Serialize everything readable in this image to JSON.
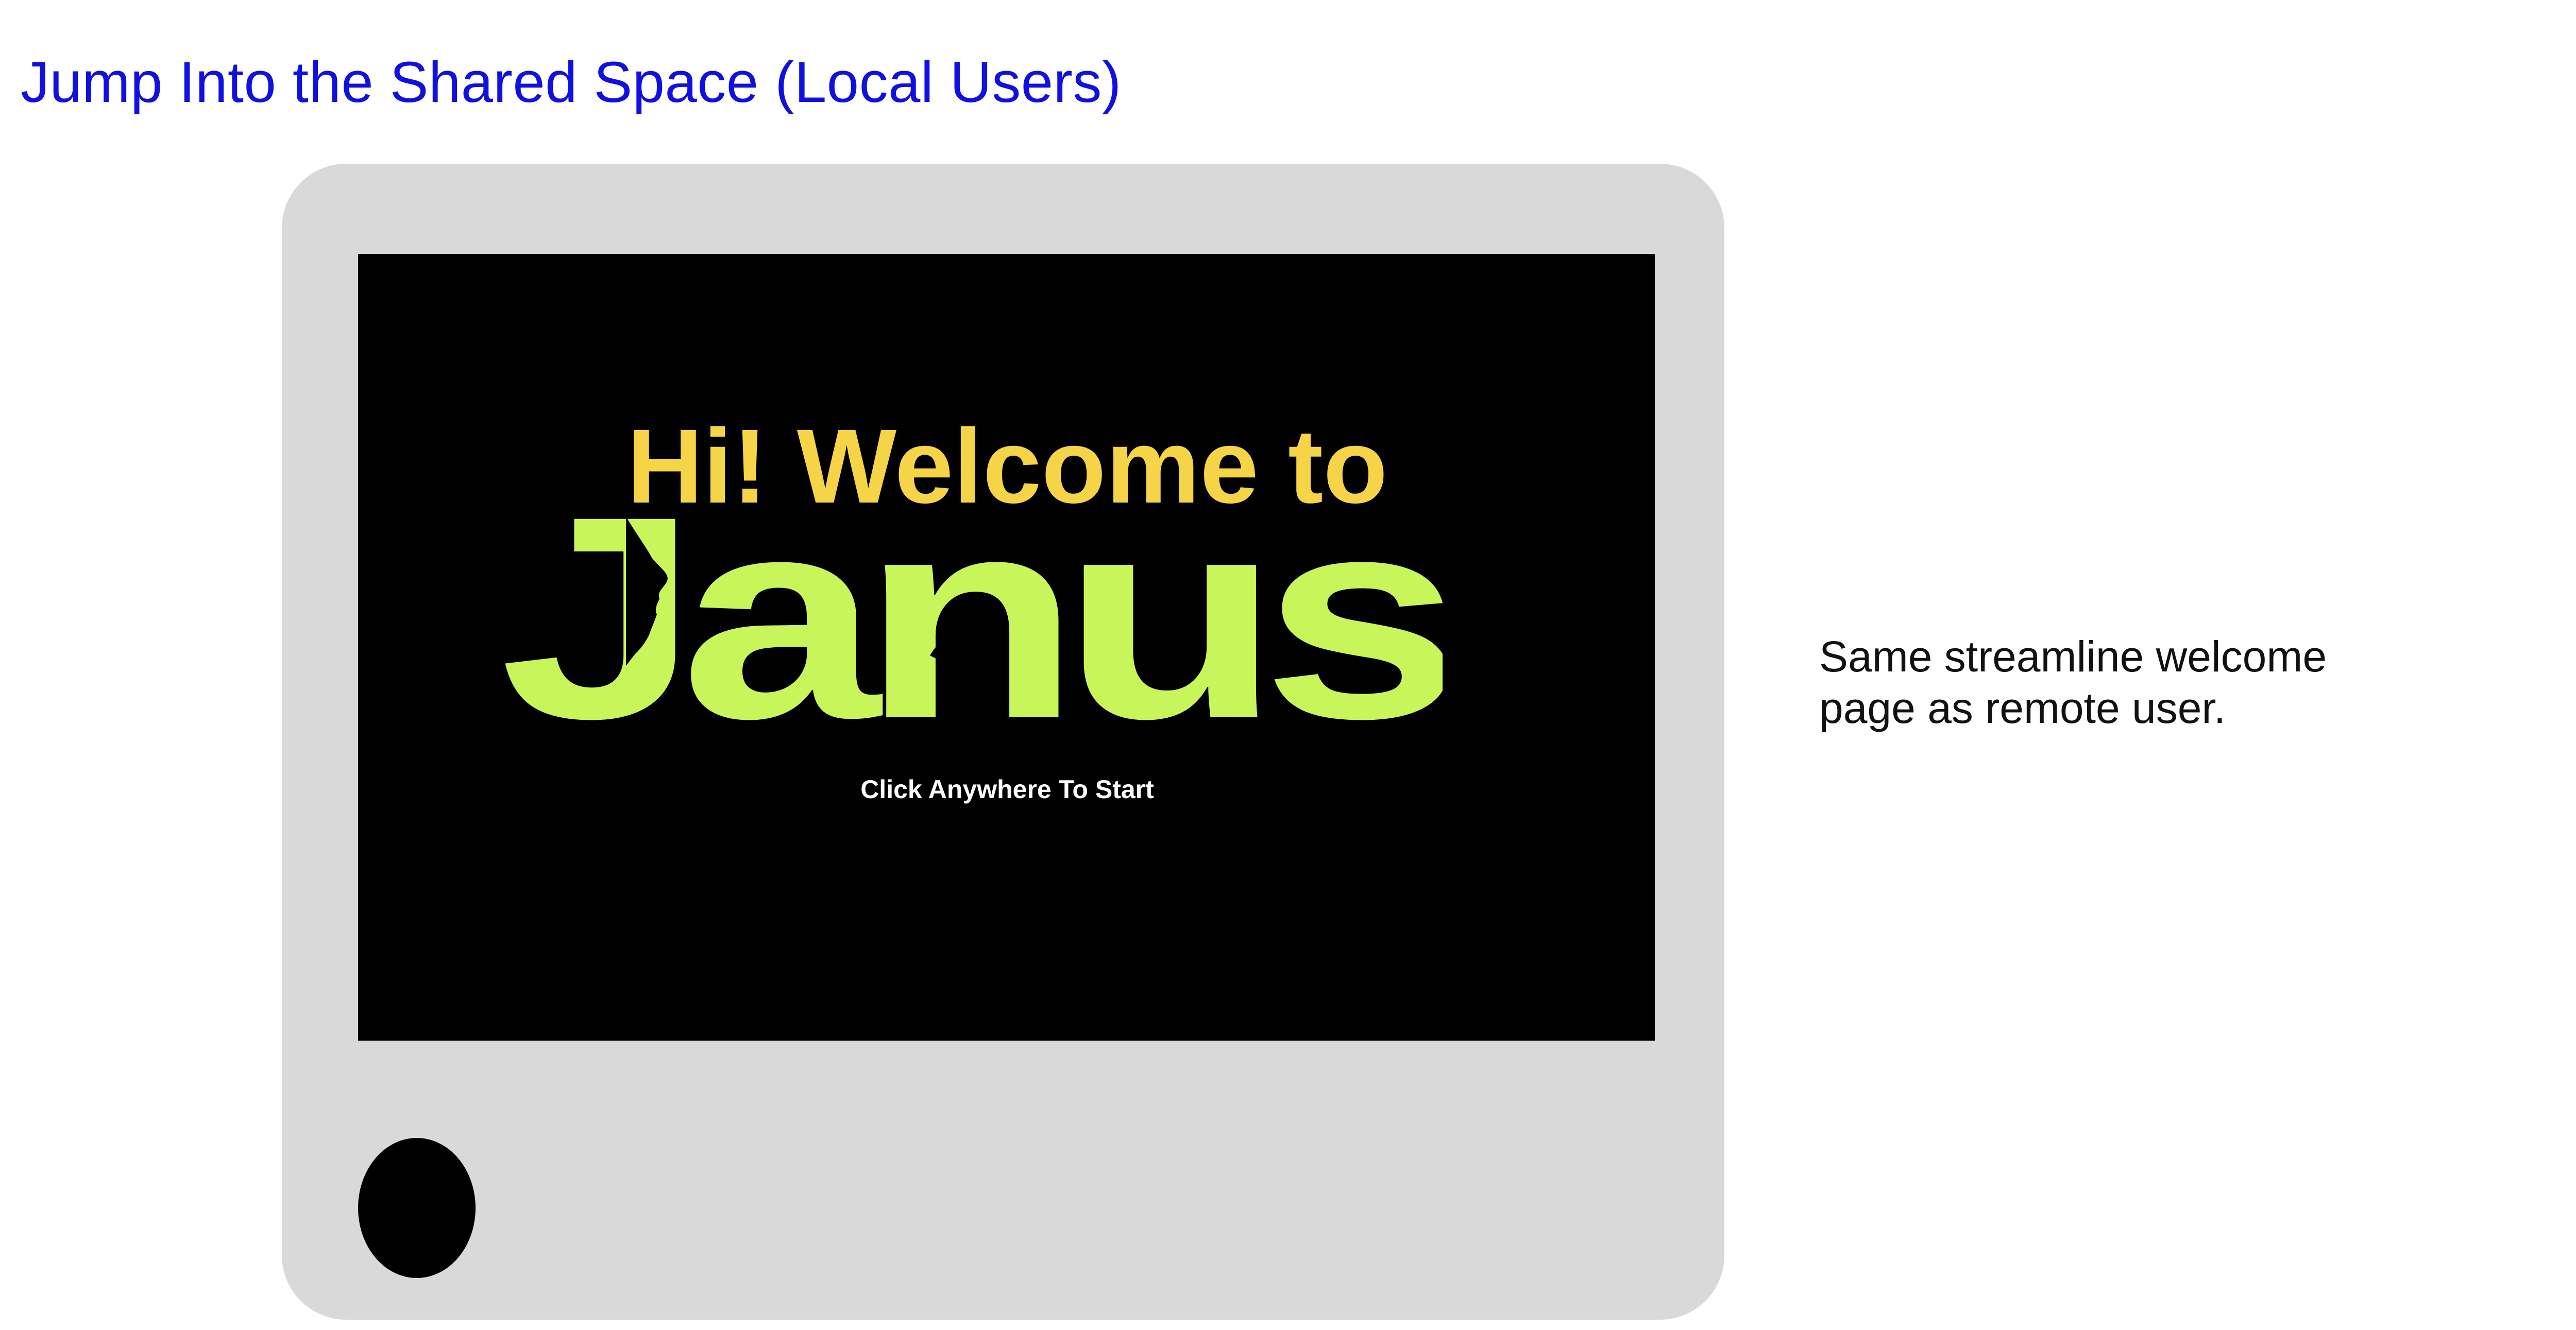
{
  "page": {
    "title": "Jump Into the Shared Space (Local Users)"
  },
  "device_screen": {
    "welcome_text": "Hi! Welcome to",
    "logo_text": "Janus",
    "cta_text": "Click Anywhere To Start"
  },
  "side_note": {
    "lines": [
      "Same streamline welcome",
      "page as remote user."
    ]
  },
  "colors": {
    "title": "#1010e0",
    "device_frame": "#d9d9d9",
    "screen_bg": "#000000",
    "welcome_text": "#f5d447",
    "logo": "#c8f55a",
    "cta_text": "#ffffff",
    "note_text": "#111111"
  },
  "icons": {
    "home_button": "home-button-circle",
    "logo_faces": "face-silhouette-icon"
  }
}
